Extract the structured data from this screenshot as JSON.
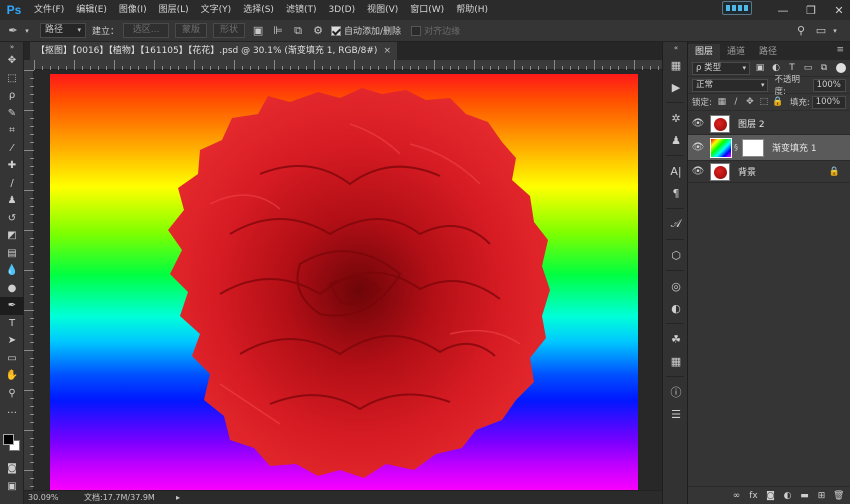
{
  "app": {
    "logo": "Ps"
  },
  "menu": [
    "文件(F)",
    "编辑(E)",
    "图像(I)",
    "图层(L)",
    "文字(Y)",
    "选择(S)",
    "滤镜(T)",
    "3D(D)",
    "视图(V)",
    "窗口(W)",
    "帮助(H)"
  ],
  "window_controls": {
    "minimize": "—",
    "restore": "❐",
    "close": "✕"
  },
  "options_bar": {
    "tool_icon": "pen-icon",
    "mode_value": "路径",
    "make_label": "建立：",
    "selection_button": "选区...",
    "mask_button": "蒙版",
    "shape_button": "形状",
    "auto_add_delete_label": "自动添加/删除",
    "auto_add_delete_checked": true,
    "align_edges_label": "对齐边缘",
    "align_edges_checked": false
  },
  "document": {
    "tab_title": "【抠图】【0016】【植物】【161105】【花花】.psd @ 30.1% (渐变填充 1, RGB/8#)",
    "tab_close": "×"
  },
  "status_bar": {
    "zoom": "30.09%",
    "doc_info": "文档:17.7M/37.9M"
  },
  "layers_panel": {
    "tabs": [
      "图层",
      "通道",
      "路径"
    ],
    "menu_icon": "≡",
    "filter_label": "ρ 类型",
    "blend_mode": "正常",
    "opacity_label": "不透明度:",
    "opacity_value": "100%",
    "lock_label": "锁定:",
    "fill_label": "填充:",
    "fill_value": "100%",
    "layers": [
      {
        "name": "图层 2",
        "type": "flower",
        "selected": false,
        "locked": false
      },
      {
        "name": "渐变填充 1",
        "type": "gradient",
        "selected": true,
        "locked": false
      },
      {
        "name": "背景",
        "type": "flower-bg",
        "selected": false,
        "locked": true
      }
    ]
  },
  "colors": {
    "foreground": "#000000",
    "background": "#ffffff",
    "flower": "#c8141c",
    "panel": "#353535"
  }
}
